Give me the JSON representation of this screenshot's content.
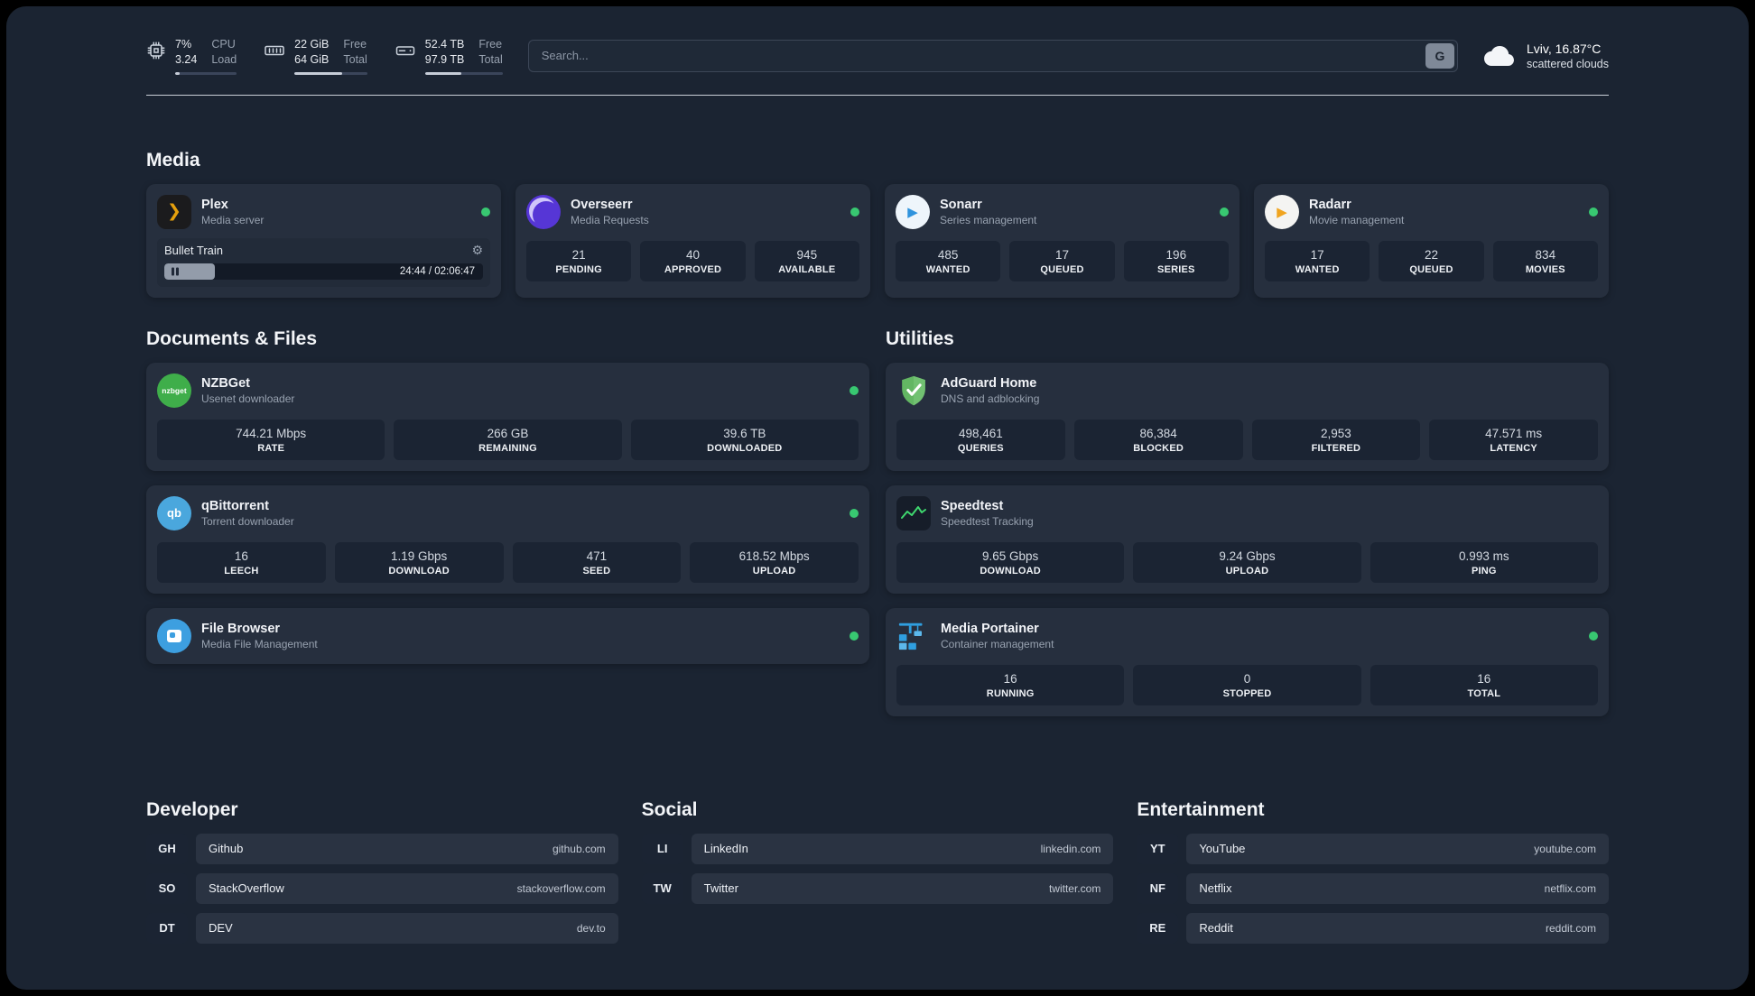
{
  "header": {
    "cpu": {
      "value_top": "7%",
      "label_top": "CPU",
      "value_bottom": "3.24",
      "label_bottom": "Load",
      "progress": 7
    },
    "ram": {
      "value_top": "22 GiB",
      "label_top": "Free",
      "value_bottom": "64 GiB",
      "label_bottom": "Total",
      "progress": 66
    },
    "disk": {
      "value_top": "52.4 TB",
      "label_top": "Free",
      "value_bottom": "97.9 TB",
      "label_bottom": "Total",
      "progress": 47
    },
    "search": {
      "placeholder": "Search...",
      "button_label": "G"
    },
    "weather": {
      "location": "Lviv, 16.87°C",
      "condition": "scattered clouds"
    }
  },
  "sections": {
    "media": {
      "title": "Media",
      "plex": {
        "title": "Plex",
        "subtitle": "Media server",
        "icon_text": "❯",
        "now_playing": "Bullet Train",
        "time": "24:44 / 02:06:47",
        "progress": 16
      },
      "overseerr": {
        "title": "Overseerr",
        "subtitle": "Media Requests",
        "stats": [
          {
            "value": "21",
            "label": "PENDING"
          },
          {
            "value": "40",
            "label": "APPROVED"
          },
          {
            "value": "945",
            "label": "AVAILABLE"
          }
        ]
      },
      "sonarr": {
        "title": "Sonarr",
        "subtitle": "Series management",
        "icon_text": "▶",
        "stats": [
          {
            "value": "485",
            "label": "WANTED"
          },
          {
            "value": "17",
            "label": "QUEUED"
          },
          {
            "value": "196",
            "label": "SERIES"
          }
        ]
      },
      "radarr": {
        "title": "Radarr",
        "subtitle": "Movie management",
        "icon_text": "▶",
        "stats": [
          {
            "value": "17",
            "label": "WANTED"
          },
          {
            "value": "22",
            "label": "QUEUED"
          },
          {
            "value": "834",
            "label": "MOVIES"
          }
        ]
      }
    },
    "documents": {
      "title": "Documents & Files",
      "nzbget": {
        "title": "NZBGet",
        "subtitle": "Usenet downloader",
        "icon_text": "nzbget",
        "stats": [
          {
            "value": "744.21 Mbps",
            "label": "RATE"
          },
          {
            "value": "266 GB",
            "label": "REMAINING"
          },
          {
            "value": "39.6 TB",
            "label": "DOWNLOADED"
          }
        ]
      },
      "qbittorrent": {
        "title": "qBittorrent",
        "subtitle": "Torrent downloader",
        "icon_text": "qb",
        "stats": [
          {
            "value": "16",
            "label": "LEECH"
          },
          {
            "value": "1.19 Gbps",
            "label": "DOWNLOAD"
          },
          {
            "value": "471",
            "label": "SEED"
          },
          {
            "value": "618.52 Mbps",
            "label": "UPLOAD"
          }
        ]
      },
      "filebrowser": {
        "title": "File Browser",
        "subtitle": "Media File Management"
      }
    },
    "utilities": {
      "title": "Utilities",
      "adguard": {
        "title": "AdGuard Home",
        "subtitle": "DNS and adblocking",
        "stats": [
          {
            "value": "498,461",
            "label": "QUERIES"
          },
          {
            "value": "86,384",
            "label": "BLOCKED"
          },
          {
            "value": "2,953",
            "label": "FILTERED"
          },
          {
            "value": "47.571 ms",
            "label": "LATENCY"
          }
        ]
      },
      "speedtest": {
        "title": "Speedtest",
        "subtitle": "Speedtest Tracking",
        "stats": [
          {
            "value": "9.65 Gbps",
            "label": "DOWNLOAD"
          },
          {
            "value": "9.24 Gbps",
            "label": "UPLOAD"
          },
          {
            "value": "0.993 ms",
            "label": "PING"
          }
        ]
      },
      "portainer": {
        "title": "Media Portainer",
        "subtitle": "Container management",
        "stats": [
          {
            "value": "16",
            "label": "RUNNING"
          },
          {
            "value": "0",
            "label": "STOPPED"
          },
          {
            "value": "16",
            "label": "TOTAL"
          }
        ]
      }
    },
    "bookmarks": [
      {
        "title": "Developer",
        "items": [
          {
            "abbr": "GH",
            "name": "Github",
            "url": "github.com"
          },
          {
            "abbr": "SO",
            "name": "StackOverflow",
            "url": "stackoverflow.com"
          },
          {
            "abbr": "DT",
            "name": "DEV",
            "url": "dev.to"
          }
        ]
      },
      {
        "title": "Social",
        "items": [
          {
            "abbr": "LI",
            "name": "LinkedIn",
            "url": "linkedin.com"
          },
          {
            "abbr": "TW",
            "name": "Twitter",
            "url": "twitter.com"
          }
        ]
      },
      {
        "title": "Entertainment",
        "items": [
          {
            "abbr": "YT",
            "name": "YouTube",
            "url": "youtube.com"
          },
          {
            "abbr": "NF",
            "name": "Netflix",
            "url": "netflix.com"
          },
          {
            "abbr": "RE",
            "name": "Reddit",
            "url": "reddit.com"
          }
        ]
      }
    ]
  }
}
